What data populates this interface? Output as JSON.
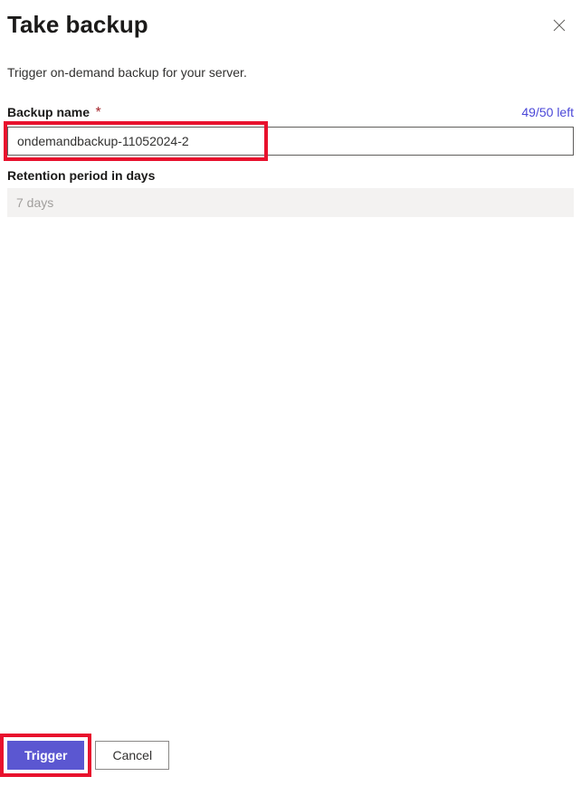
{
  "header": {
    "title": "Take backup"
  },
  "description": "Trigger on-demand backup for your server.",
  "fields": {
    "backupName": {
      "label": "Backup name",
      "required": "*",
      "value": "ondemandbackup-11052024-2",
      "counter": "49/50 left"
    },
    "retention": {
      "label": "Retention period in days",
      "value": "7 days"
    }
  },
  "buttons": {
    "trigger": "Trigger",
    "cancel": "Cancel"
  }
}
